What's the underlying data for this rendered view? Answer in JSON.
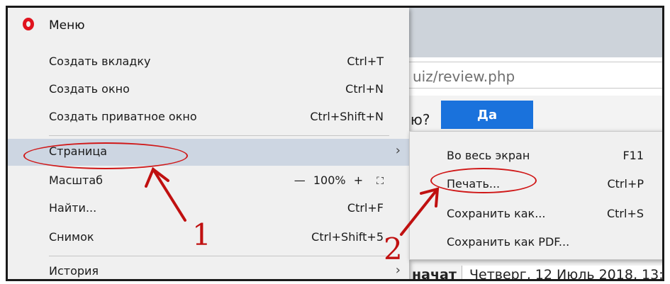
{
  "browser": {
    "address_text": "uiz/review.php",
    "question_text": "ю?",
    "yes_label": "Да",
    "bottom_label": "начат",
    "bottom_value": "Четверг, 12 Июль 2018, 13:"
  },
  "menu": {
    "title": "Меню",
    "items": [
      {
        "label": "Создать вкладку",
        "shortcut": "Ctrl+T"
      },
      {
        "label": "Создать окно",
        "shortcut": "Ctrl+N"
      },
      {
        "label": "Создать приватное окно",
        "shortcut": "Ctrl+Shift+N"
      },
      {
        "label": "Страница",
        "arrow": "›"
      },
      {
        "label": "Масштаб",
        "zoom_minus": "—",
        "zoom_value": "100%",
        "zoom_plus": "+",
        "zoom_full": "⛶"
      },
      {
        "label": "Найти...",
        "shortcut": "Ctrl+F"
      },
      {
        "label": "Снимок",
        "shortcut": "Ctrl+Shift+5"
      },
      {
        "label": "История",
        "arrow": "›"
      }
    ]
  },
  "submenu": {
    "items": [
      {
        "label": "Во весь экран",
        "shortcut": "F11"
      },
      {
        "label": "Печать...",
        "shortcut": "Ctrl+P"
      },
      {
        "label": "Сохранить как...",
        "shortcut": "Ctrl+S"
      },
      {
        "label": "Сохранить как PDF..."
      }
    ]
  },
  "annotations": {
    "label_1": "1",
    "label_2": "2",
    "color": "#d01818"
  },
  "icons": {
    "logo": "opera-logo-icon",
    "submenu_arrow": "chevron-right-icon",
    "fullscreen": "fullscreen-icon"
  }
}
